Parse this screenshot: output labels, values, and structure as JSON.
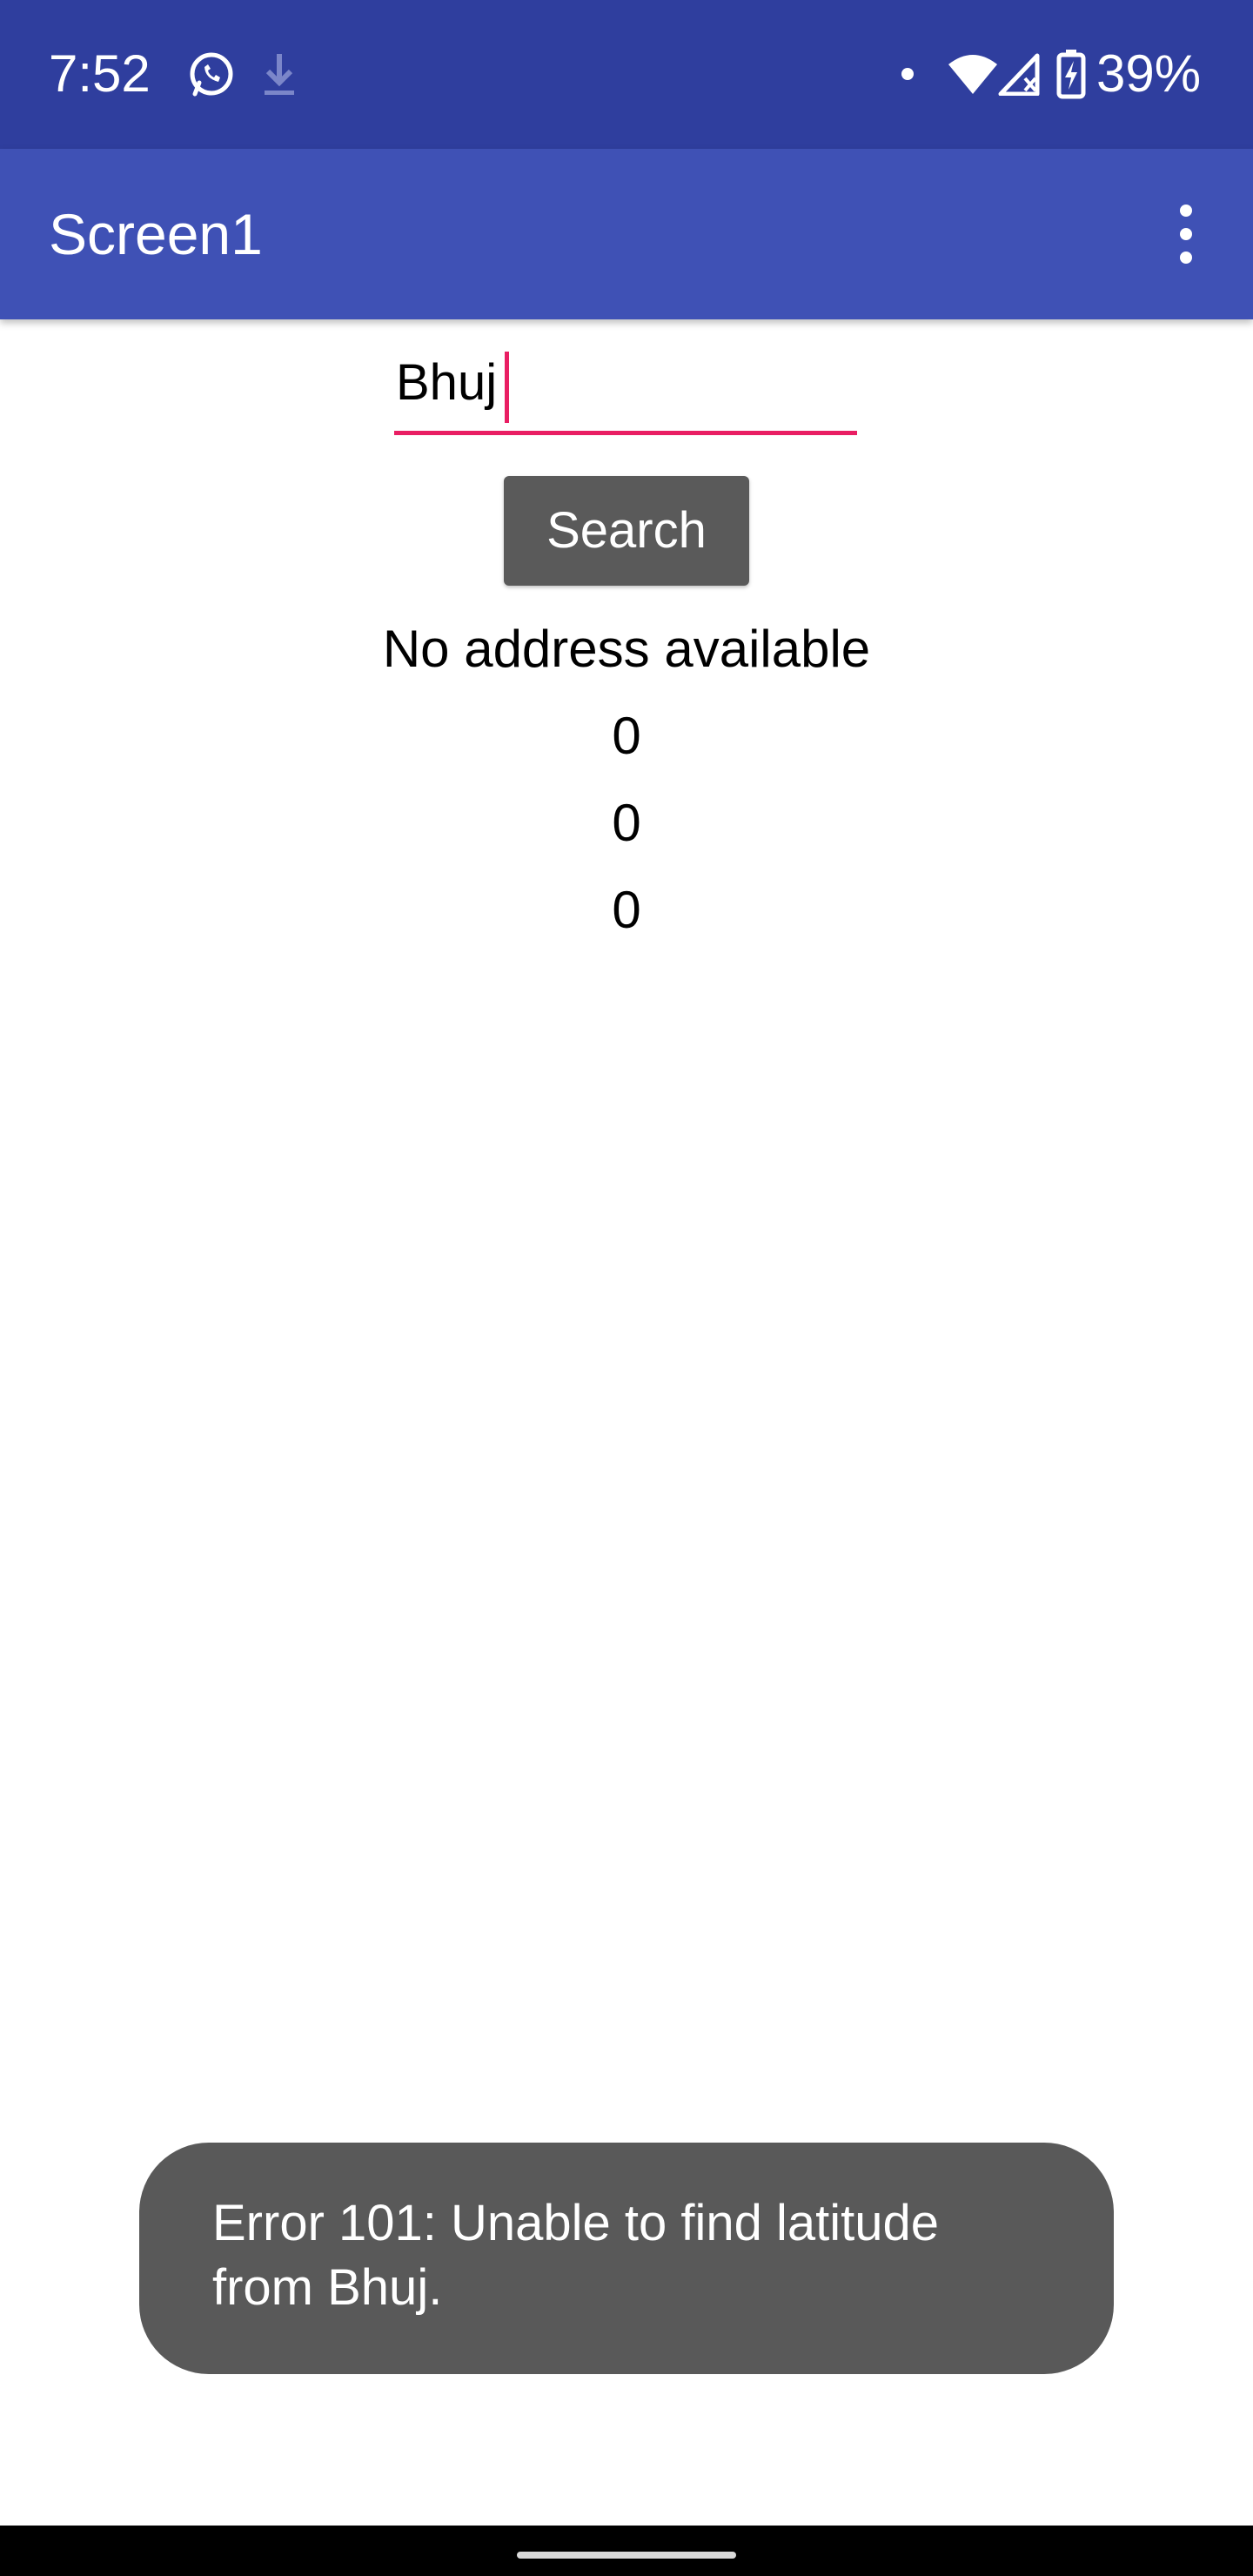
{
  "status_bar": {
    "time": "7:52",
    "battery_percent": "39%",
    "icons": [
      "whatsapp-icon",
      "download-icon",
      "notification-dot",
      "wifi-icon",
      "cell-signal-icon",
      "battery-charging-icon"
    ],
    "background_color": "#2f3e9e"
  },
  "app_bar": {
    "title": "Screen1",
    "menu_icon": "more-vert-icon",
    "background_color": "#3f51b5"
  },
  "search": {
    "value": "Bhuj",
    "underline_color": "#e91e63"
  },
  "search_button": {
    "label": "Search"
  },
  "results": {
    "address": "No address available",
    "value_1": "0",
    "value_2": "0",
    "value_3": "0"
  },
  "toast": {
    "line_1": "Error 101: Unable to find latitude",
    "line_2": "from Bhuj."
  }
}
